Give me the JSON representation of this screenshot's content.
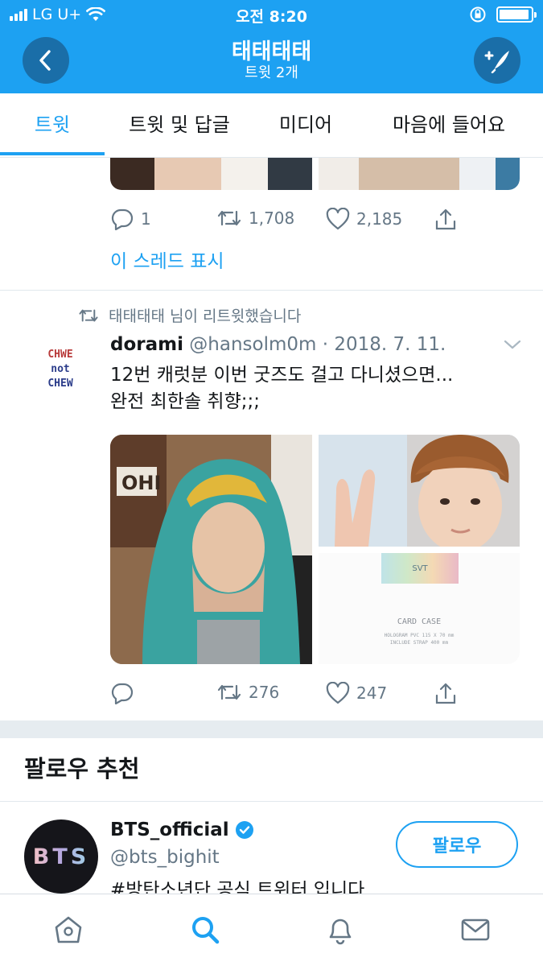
{
  "status_bar": {
    "carrier": "LG U+",
    "time": "오전 8:20",
    "battery_level": 0.95
  },
  "header": {
    "title": "태태태태",
    "subtitle": "트윗 2개",
    "back_icon": "chevron-left-icon",
    "compose_icon": "compose-tweet-icon"
  },
  "tabs": [
    {
      "label": "트윗",
      "active": true
    },
    {
      "label": "트윗 및 답글"
    },
    {
      "label": "미디어"
    },
    {
      "label": "마음에 들어요"
    }
  ],
  "tweet1": {
    "reply_count": "1",
    "retweet_count": "1,708",
    "like_count": "2,185",
    "thread_link": "이 스레드 표시"
  },
  "tweet2": {
    "retweeted_by": "태태태태 님이 리트윗했습니다",
    "avatar_lines": [
      "CHWE",
      "not",
      "CHEW"
    ],
    "name": "dorami",
    "handle": "@hansolm0m",
    "date": "· 2018. 7. 11.",
    "text_line1": "12번 캐럿분 이번 굿즈도 걸고 다니셨으면...",
    "text_line2": "완전 최한솔 취향;;;",
    "media_card": {
      "brand": "SVT",
      "title": "CARD CASE",
      "detail1": "HOLOGRAM PVC 115 X 70 mm",
      "detail2": "INCLUDE STRAP 400 mm"
    },
    "reply_count": "",
    "retweet_count": "276",
    "like_count": "247"
  },
  "follow_suggestions": {
    "title": "팔로우 추천",
    "account": {
      "avatar_text": "BTS",
      "name": "BTS_official",
      "handle": "@bts_bighit",
      "bio": "#방탄소년단 공식 트위터 입니다.",
      "follow_label": "팔로우"
    }
  },
  "colors": {
    "brand": "#1da1f2",
    "muted": "#657786"
  },
  "bottom_nav": [
    "home-icon",
    "search-icon",
    "notifications-icon",
    "messages-icon"
  ]
}
